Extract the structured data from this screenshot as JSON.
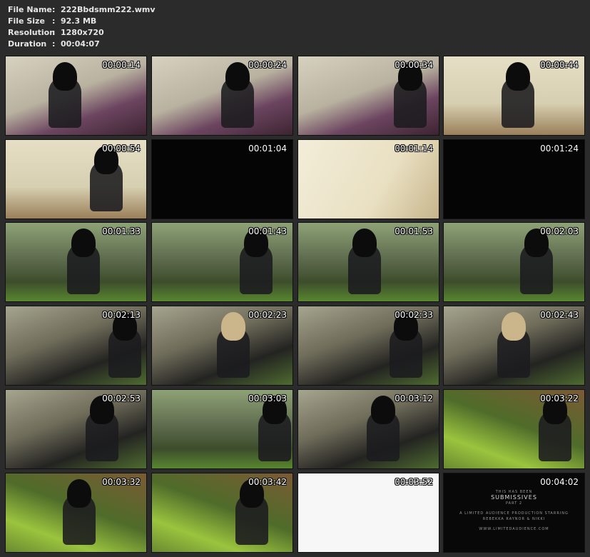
{
  "header": {
    "rows": [
      {
        "label": "File Name",
        "value": "222Bbdsmm222.wmv"
      },
      {
        "label": "File Size",
        "value": "92.3 MB"
      },
      {
        "label": "Resolution",
        "value": "1280x720"
      },
      {
        "label": "Duration",
        "value": "00:04:07"
      }
    ],
    "separator": ":"
  },
  "thumbnails": [
    {
      "time": "00:00:14",
      "scene": "kitchen"
    },
    {
      "time": "00:00:24",
      "scene": "kitchen"
    },
    {
      "time": "00:00:34",
      "scene": "kitchen"
    },
    {
      "time": "00:00:44",
      "scene": "wall"
    },
    {
      "time": "00:00:54",
      "scene": "wall"
    },
    {
      "time": "00:01:04",
      "scene": "black"
    },
    {
      "time": "00:01:14",
      "scene": "cream"
    },
    {
      "time": "00:01:24",
      "scene": "black"
    },
    {
      "time": "00:01:33",
      "scene": "garden"
    },
    {
      "time": "00:01:43",
      "scene": "garden"
    },
    {
      "time": "00:01:53",
      "scene": "garden"
    },
    {
      "time": "00:02:03",
      "scene": "garden"
    },
    {
      "time": "00:02:13",
      "scene": "close"
    },
    {
      "time": "00:02:23",
      "scene": "close"
    },
    {
      "time": "00:02:33",
      "scene": "close"
    },
    {
      "time": "00:02:43",
      "scene": "close"
    },
    {
      "time": "00:02:53",
      "scene": "close"
    },
    {
      "time": "00:03:03",
      "scene": "garden"
    },
    {
      "time": "00:03:12",
      "scene": "close"
    },
    {
      "time": "00:03:22",
      "scene": "leaves"
    },
    {
      "time": "00:03:32",
      "scene": "leaves"
    },
    {
      "time": "00:03:42",
      "scene": "leaves"
    },
    {
      "time": "00:03:52",
      "scene": "white"
    },
    {
      "time": "00:04:02",
      "scene": "title"
    }
  ],
  "title_card": {
    "line1": "THIS HAS BEEN",
    "line2": "SUBMISSIVES",
    "line3": "PART 2",
    "line4": "A LIMITED AUDIENCE PRODUCTION STARRING",
    "line5": "REBEKKA RAYNOR & NIKKI",
    "line6": "WWW.LIMITEDAUDIENCE.COM"
  }
}
